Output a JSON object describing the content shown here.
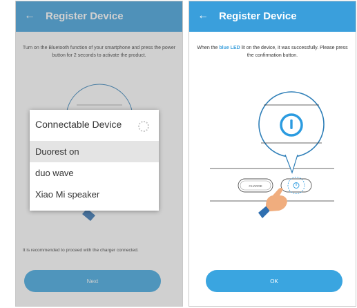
{
  "left_screen": {
    "appbar": {
      "title": "Register Device",
      "back_icon": "arrow-left-icon"
    },
    "instruction": "Turn on the Bluetooth function of your smartphone and press the power button for 2 seconds to activate the product.",
    "dialog": {
      "title": "Connectable Device",
      "spinner_icon": "loading-spinner-icon",
      "devices": [
        {
          "name": "Duorest on",
          "selected": true
        },
        {
          "name": "duo wave",
          "selected": false
        },
        {
          "name": "Xiao Mi speaker",
          "selected": false
        }
      ]
    },
    "note": "It is recommended to proceed with the charger connected.",
    "next_button": "Next"
  },
  "right_screen": {
    "appbar": {
      "title": "Register Device",
      "back_icon": "arrow-left-icon"
    },
    "instruction_before": "When the ",
    "instruction_highlight": "blue LED",
    "instruction_after": " lit on the device, it was successfully. Please press the confirmation button.",
    "illustration": {
      "charge_label": "CHARGE",
      "power_icon": "power-icon",
      "hand_icon": "pointing-hand-icon"
    },
    "ok_button": "OK"
  },
  "colors": {
    "appbar": "#3a9fdc",
    "button": "#3aa5e0",
    "highlight": "#3a9fdc",
    "dim_overlay": "rgba(120,120,120,0.35)"
  }
}
